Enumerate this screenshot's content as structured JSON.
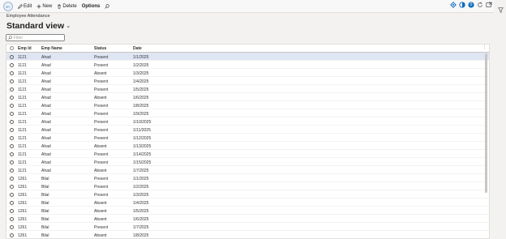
{
  "toolbar": {
    "edit_label": "Edit",
    "new_label": "New",
    "delete_label": "Delete",
    "options_label": "Options",
    "right_badge": "0"
  },
  "page": {
    "caption": "Employee Attendance",
    "view_title": "Standard view",
    "filter_placeholder": "Filter"
  },
  "grid": {
    "columns": [
      "Emp Id",
      "Emp Name",
      "Status",
      "Date"
    ],
    "rows": [
      [
        "1121",
        "Ahad",
        "Present",
        "1/1/2025"
      ],
      [
        "1121",
        "Ahad",
        "Present",
        "1/2/2025"
      ],
      [
        "1121",
        "Ahad",
        "Absent",
        "1/3/2025"
      ],
      [
        "1121",
        "Ahad",
        "Present",
        "1/4/2025"
      ],
      [
        "1121",
        "Ahad",
        "Present",
        "1/5/2025"
      ],
      [
        "1121",
        "Ahad",
        "Absent",
        "1/6/2025"
      ],
      [
        "1121",
        "Ahad",
        "Present",
        "1/8/2025"
      ],
      [
        "1121",
        "Ahad",
        "Present",
        "1/9/2025"
      ],
      [
        "1121",
        "Ahad",
        "Present",
        "1/10/2025"
      ],
      [
        "1121",
        "Ahad",
        "Present",
        "1/11/2025"
      ],
      [
        "1121",
        "Ahad",
        "Present",
        "1/12/2025"
      ],
      [
        "1121",
        "Ahad",
        "Absent",
        "1/13/2025"
      ],
      [
        "1121",
        "Ahad",
        "Present",
        "1/14/2025"
      ],
      [
        "1121",
        "Ahad",
        "Present",
        "1/15/2025"
      ],
      [
        "1121",
        "Ahad",
        "Absent",
        "1/7/2025"
      ],
      [
        "1261",
        "Bilal",
        "Present",
        "1/1/2025"
      ],
      [
        "1261",
        "Bilal",
        "Present",
        "1/2/2025"
      ],
      [
        "1261",
        "Bilal",
        "Present",
        "1/3/2025"
      ],
      [
        "1261",
        "Bilal",
        "Absent",
        "1/4/2025"
      ],
      [
        "1261",
        "Bilal",
        "Absent",
        "1/5/2025"
      ],
      [
        "1261",
        "Bilal",
        "Absent",
        "1/6/2025"
      ],
      [
        "1261",
        "Bilal",
        "Present",
        "1/7/2025"
      ],
      [
        "1261",
        "Bilal",
        "Absent",
        "1/8/2025"
      ]
    ],
    "selected_row": 0
  },
  "colors": {
    "accent": "#0f6cbd",
    "selected_row": "#dfe6f3"
  }
}
